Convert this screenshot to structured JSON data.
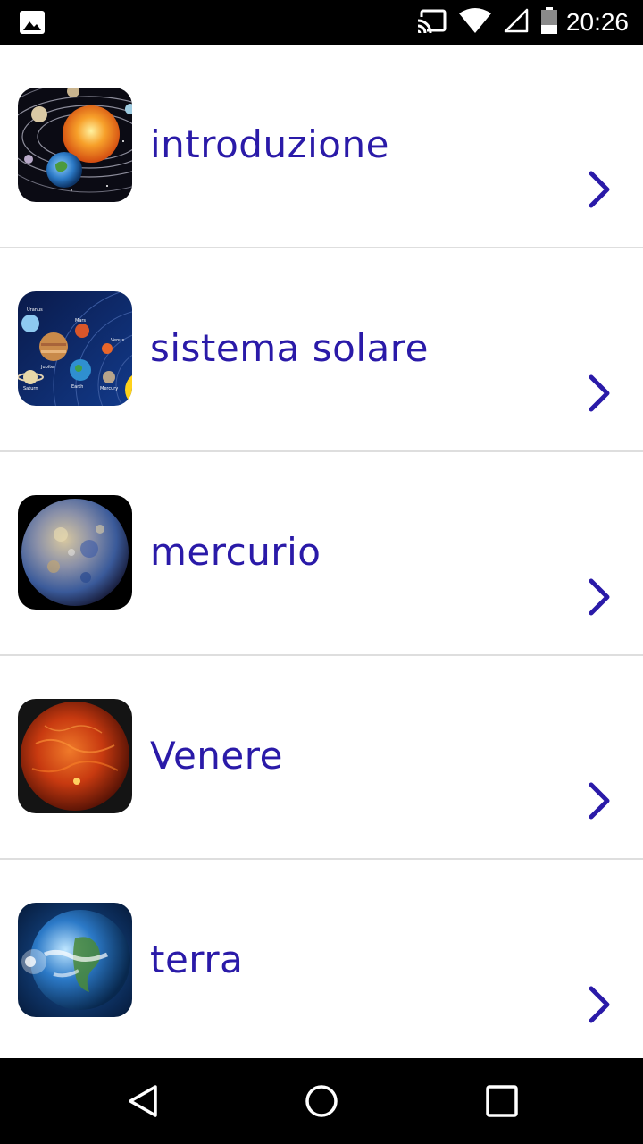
{
  "status_bar": {
    "time": "20:26",
    "icons": [
      "gallery-icon",
      "cast-icon",
      "wifi-icon",
      "signal-icon",
      "battery-icon"
    ]
  },
  "list": {
    "items": [
      {
        "label": "introduzione",
        "icon": "solar-system-orbit-image"
      },
      {
        "label": "sistema solare",
        "icon": "solar-system-planets-image"
      },
      {
        "label": "mercurio",
        "icon": "mercury-planet-image"
      },
      {
        "label": "Venere",
        "icon": "venus-planet-image"
      },
      {
        "label": "terra",
        "icon": "earth-planet-image"
      }
    ],
    "label_color": "#2a1aa8",
    "chevron_color": "#2a1aa8"
  },
  "nav_bar": {
    "buttons": [
      "back-icon",
      "home-icon",
      "recents-icon"
    ]
  }
}
